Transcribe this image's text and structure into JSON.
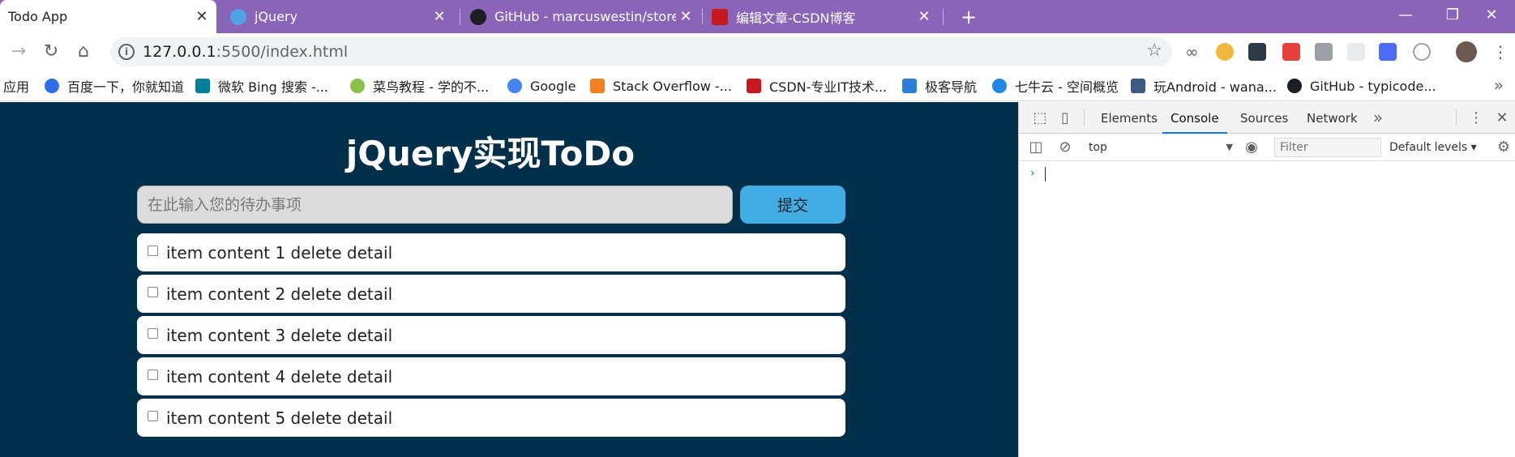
{
  "browser": {
    "tabs": [
      {
        "title": "Todo App",
        "active": true
      },
      {
        "title": "jQuery",
        "active": false
      },
      {
        "title": "GitHub - marcuswestin/store.js",
        "active": false
      },
      {
        "title": "编辑文章-CSDN博客",
        "active": false
      }
    ],
    "new_tab": "+",
    "window_controls": {
      "minimize": "—",
      "maximize": "❐",
      "close": "✕"
    },
    "url": {
      "host": "127.0.0.1",
      "path": ":5500/index.html"
    },
    "bookmarks": [
      {
        "label": "应用"
      },
      {
        "label": "百度一下，你就知道"
      },
      {
        "label": "微软 Bing 搜索 -..."
      },
      {
        "label": "菜鸟教程 - 学的不..."
      },
      {
        "label": "Google"
      },
      {
        "label": "Stack Overflow -..."
      },
      {
        "label": "CSDN-专业IT技术..."
      },
      {
        "label": "极客导航"
      },
      {
        "label": "七牛云 - 空间概览"
      },
      {
        "label": "玩Android - wana..."
      },
      {
        "label": "GitHub - typicode..."
      }
    ],
    "bookmarks_more": "»"
  },
  "page": {
    "title": "jQuery实现ToDo",
    "input_placeholder": "在此输入您的待办事项",
    "submit_label": "提交",
    "todos": [
      {
        "text": "item content 1 delete detail"
      },
      {
        "text": "item content 2 delete detail"
      },
      {
        "text": "item content 3 delete detail"
      },
      {
        "text": "item content 4 delete detail"
      },
      {
        "text": "item content 5 delete detail"
      }
    ]
  },
  "devtools": {
    "tabs": [
      "Elements",
      "Console",
      "Sources",
      "Network"
    ],
    "active_tab": "Console",
    "more": "»",
    "context": "top",
    "filter_placeholder": "Filter",
    "levels": "Default levels ▾",
    "prompt": "›"
  },
  "colors": {
    "tabstrip": "#8a64b9",
    "page_bg": "#02304b",
    "submit_bg": "#42ade4"
  }
}
